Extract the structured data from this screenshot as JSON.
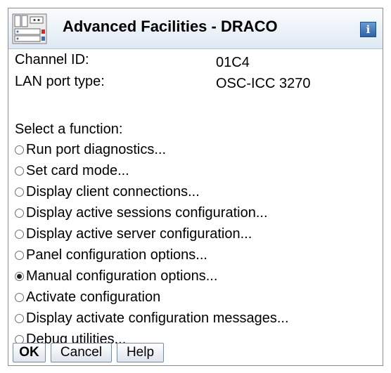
{
  "window": {
    "title": "Advanced Facilities - DRACO",
    "icon": "server-rack-icon",
    "info_icon": "info-icon",
    "info_glyph": "i"
  },
  "fields": [
    {
      "label": "Channel ID:",
      "value": "01C4"
    },
    {
      "label": "LAN port type:",
      "value": "OSC-ICC 3270"
    }
  ],
  "function_prompt": "Select a function:",
  "functions": [
    {
      "label": "Run port diagnostics...",
      "selected": false
    },
    {
      "label": "Set card mode...",
      "selected": false
    },
    {
      "label": "Display client connections...",
      "selected": false
    },
    {
      "label": "Display active sessions configuration...",
      "selected": false
    },
    {
      "label": "Display active server configuration...",
      "selected": false
    },
    {
      "label": "Panel configuration options...",
      "selected": false
    },
    {
      "label": "Manual configuration options...",
      "selected": true
    },
    {
      "label": "Activate configuration",
      "selected": false
    },
    {
      "label": "Display activate configuration messages...",
      "selected": false
    },
    {
      "label": "Debug utilities...",
      "selected": false
    }
  ],
  "buttons": {
    "ok": "OK",
    "cancel": "Cancel",
    "help": "Help"
  },
  "colors": {
    "title_bar": "#dfe9f4",
    "info_button": "#2f63a8",
    "border": "#8c8c8c"
  }
}
